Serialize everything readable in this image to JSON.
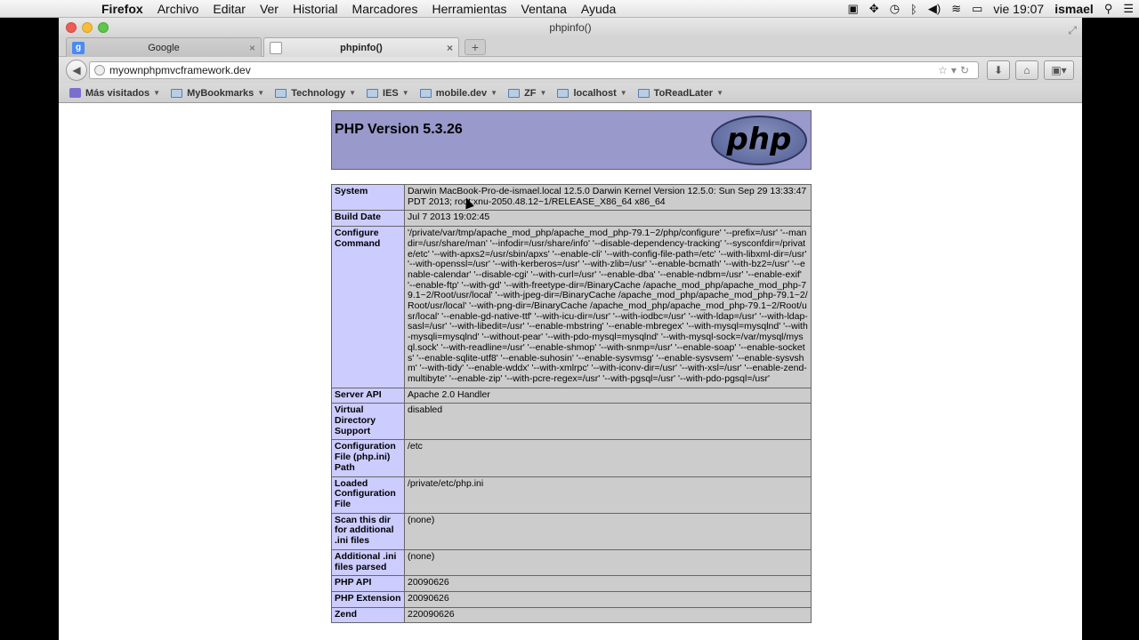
{
  "menubar": {
    "app": "Firefox",
    "items": [
      "Archivo",
      "Editar",
      "Ver",
      "Historial",
      "Marcadores",
      "Herramientas",
      "Ventana",
      "Ayuda"
    ],
    "clock": "vie 19:07",
    "user": "ismael"
  },
  "window": {
    "title": "phpinfo()"
  },
  "tabs": [
    {
      "label": "Google",
      "close": "×"
    },
    {
      "label": "phpinfo()",
      "close": "×"
    }
  ],
  "newtab": "+",
  "url": "myownphpmvcframework.dev",
  "bookmarks": [
    "Más visitados",
    "MyBookmarks",
    "Technology",
    "IES",
    "mobile.dev",
    "ZF",
    "localhost",
    "ToReadLater"
  ],
  "php": {
    "title": "PHP Version 5.3.26",
    "logo": "php",
    "rows": [
      {
        "key": "System",
        "value": "Darwin MacBook-Pro-de-ismael.local 12.5.0 Darwin Kernel Version 12.5.0: Sun Sep 29 13:33:47 PDT 2013; root:xnu-2050.48.12~1/RELEASE_X86_64 x86_64"
      },
      {
        "key": "Build Date",
        "value": "Jul 7 2013 19:02:45"
      },
      {
        "key": "Configure Command",
        "value": "'/private/var/tmp/apache_mod_php/apache_mod_php-79.1~2/php/configure' '--prefix=/usr' '--mandir=/usr/share/man' '--infodir=/usr/share/info' '--disable-dependency-tracking' '--sysconfdir=/private/etc' '--with-apxs2=/usr/sbin/apxs' '--enable-cli' '--with-config-file-path=/etc' '--with-libxml-dir=/usr' '--with-openssl=/usr' '--with-kerberos=/usr' '--with-zlib=/usr' '--enable-bcmath' '--with-bz2=/usr' '--enable-calendar' '--disable-cgi' '--with-curl=/usr' '--enable-dba' '--enable-ndbm=/usr' '--enable-exif' '--enable-ftp' '--with-gd' '--with-freetype-dir=/BinaryCache /apache_mod_php/apache_mod_php-79.1~2/Root/usr/local' '--with-jpeg-dir=/BinaryCache /apache_mod_php/apache_mod_php-79.1~2/Root/usr/local' '--with-png-dir=/BinaryCache /apache_mod_php/apache_mod_php-79.1~2/Root/usr/local' '--enable-gd-native-ttf' '--with-icu-dir=/usr' '--with-iodbc=/usr' '--with-ldap=/usr' '--with-ldap-sasl=/usr' '--with-libedit=/usr' '--enable-mbstring' '--enable-mbregex' '--with-mysql=mysqlnd' '--with-mysqli=mysqlnd' '--without-pear' '--with-pdo-mysql=mysqlnd' '--with-mysql-sock=/var/mysql/mysql.sock' '--with-readline=/usr' '--enable-shmop' '--with-snmp=/usr' '--enable-soap' '--enable-sockets' '--enable-sqlite-utf8' '--enable-suhosin' '--enable-sysvmsg' '--enable-sysvsem' '--enable-sysvshm' '--with-tidy' '--enable-wddx' '--with-xmlrpc' '--with-iconv-dir=/usr' '--with-xsl=/usr' '--enable-zend-multibyte' '--enable-zip' '--with-pcre-regex=/usr' '--with-pgsql=/usr' '--with-pdo-pgsql=/usr'"
      },
      {
        "key": "Server API",
        "value": "Apache 2.0 Handler"
      },
      {
        "key": "Virtual Directory Support",
        "value": "disabled"
      },
      {
        "key": "Configuration File (php.ini) Path",
        "value": "/etc"
      },
      {
        "key": "Loaded Configuration File",
        "value": "/private/etc/php.ini"
      },
      {
        "key": "Scan this dir for additional .ini files",
        "value": "(none)"
      },
      {
        "key": "Additional .ini files parsed",
        "value": "(none)"
      },
      {
        "key": "PHP API",
        "value": "20090626"
      },
      {
        "key": "PHP Extension",
        "value": "20090626"
      },
      {
        "key": "Zend",
        "value": "220090626"
      }
    ]
  }
}
